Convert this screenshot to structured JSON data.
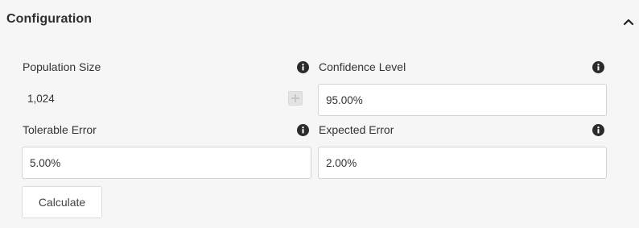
{
  "panel": {
    "title": "Configuration",
    "collapse_icon": "chevron-up-icon"
  },
  "fields": {
    "population_size": {
      "label": "Population Size",
      "value": "1,024",
      "info_icon": "info-icon",
      "action_icon": "calculator-icon"
    },
    "confidence_level": {
      "label": "Confidence Level",
      "value": "95.00%",
      "info_icon": "info-icon"
    },
    "tolerable_error": {
      "label": "Tolerable Error",
      "value": "5.00%",
      "info_icon": "info-icon"
    },
    "expected_error": {
      "label": "Expected Error",
      "value": "2.00%",
      "info_icon": "info-icon"
    }
  },
  "actions": {
    "calculate_label": "Calculate"
  },
  "colors": {
    "page_background": "#f6f6f6",
    "field_background": "#ffffff",
    "field_border": "#d4d4d4",
    "icon": "#2b2b2b"
  }
}
